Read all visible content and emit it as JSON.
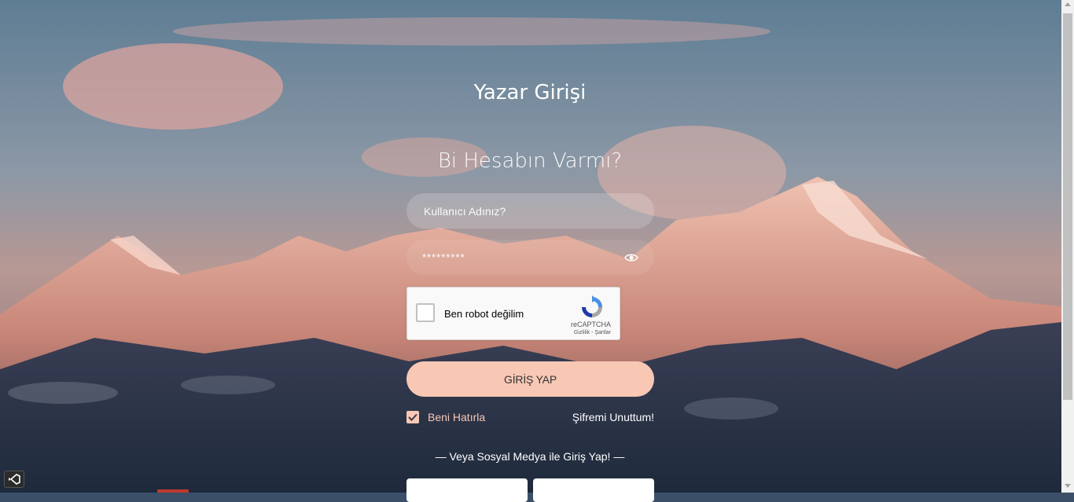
{
  "page": {
    "title": "Yazar Girişi",
    "subtitle": "Bi Hesabın Varmı?"
  },
  "form": {
    "username_placeholder": "Kullanıcı Adınız?",
    "password_mask": "*********",
    "login_button": "GİRİŞ YAP",
    "remember_label": "Beni Hatırla",
    "remember_checked": true,
    "forgot_link": "Şifremi Unuttum!"
  },
  "captcha": {
    "label": "Ben robot değilim",
    "brand": "reCAPTCHA",
    "privacy": "Gizlilik",
    "separator": " - ",
    "terms": "Şartlar"
  },
  "social": {
    "text": "— Veya Sosyal Medya ile Giriş Yap! —"
  },
  "icons": {
    "password_toggle": "eye-icon",
    "captcha_logo": "recaptcha-logo-icon",
    "taskbar_app": "visual-studio-icon"
  },
  "colors": {
    "accent": "#f8c8b5",
    "text": "#ffffff"
  }
}
